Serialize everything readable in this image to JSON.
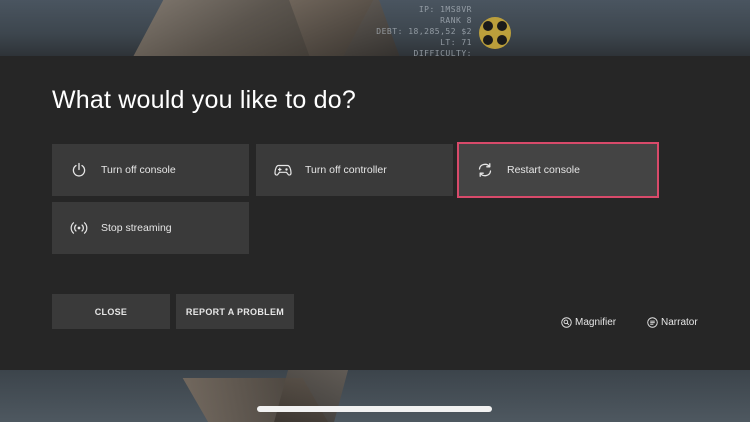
{
  "background": {
    "hud_lines": [
      "IP: 1MS8VR",
      "RANK 8",
      "DEBT: 18,285,52 $2",
      "LT: 71",
      "DIFFICULTY: STANDARD"
    ]
  },
  "dialog": {
    "title": "What would you like to do?",
    "options": [
      {
        "label": "Turn off console",
        "icon": "power-icon"
      },
      {
        "label": "Turn off controller",
        "icon": "controller-icon"
      },
      {
        "label": "Restart console",
        "icon": "restart-icon",
        "focused": true
      },
      {
        "label": "Stop streaming",
        "icon": "streaming-icon"
      }
    ],
    "buttons": {
      "close": "CLOSE",
      "report": "REPORT A PROBLEM"
    },
    "accessibility": {
      "magnifier": "Magnifier",
      "narrator": "Narrator"
    }
  },
  "colors": {
    "dialog_bg": "#262626",
    "tile_bg": "#3a3a3a",
    "focus_border": "#d84a6a",
    "text": "#e6e6e6"
  }
}
